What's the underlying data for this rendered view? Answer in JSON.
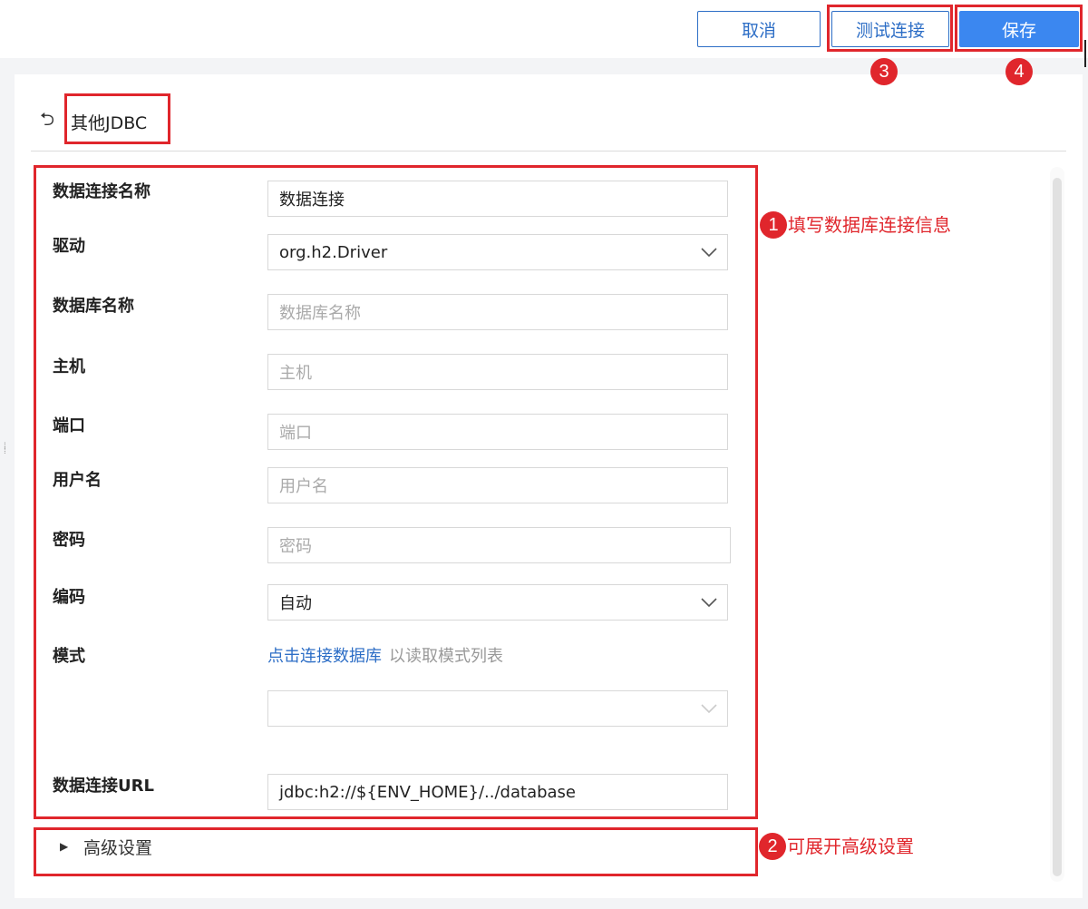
{
  "toolbar": {
    "cancel_label": "取消",
    "test_label": "测试连接",
    "save_label": "保存"
  },
  "header": {
    "title": "其他JDBC"
  },
  "form": {
    "name": {
      "label": "数据连接名称",
      "value": "数据连接"
    },
    "driver": {
      "label": "驱动",
      "value": "org.h2.Driver"
    },
    "database": {
      "label": "数据库名称",
      "placeholder": "数据库名称"
    },
    "host": {
      "label": "主机",
      "placeholder": "主机"
    },
    "port": {
      "label": "端口",
      "placeholder": "端口"
    },
    "username": {
      "label": "用户名",
      "placeholder": "用户名"
    },
    "password": {
      "label": "密码",
      "placeholder": "密码"
    },
    "encoding": {
      "label": "编码",
      "value": "自动"
    },
    "schema": {
      "label": "模式",
      "link": "点击连接数据库",
      "hint": "以读取模式列表",
      "value": ""
    },
    "url": {
      "label": "数据连接URL",
      "value": "jdbc:h2://${ENV_HOME}/../database"
    }
  },
  "advanced": {
    "label": "高级设置"
  },
  "annotations": {
    "a1": {
      "number": "1",
      "text": "填写数据库连接信息"
    },
    "a2": {
      "number": "2",
      "text": "可展开高级设置"
    },
    "a3": {
      "number": "3"
    },
    "a4": {
      "number": "4"
    }
  },
  "colors": {
    "accent": "#3b87f0",
    "link": "#2d6ec6",
    "annotation": "#e0262c"
  }
}
